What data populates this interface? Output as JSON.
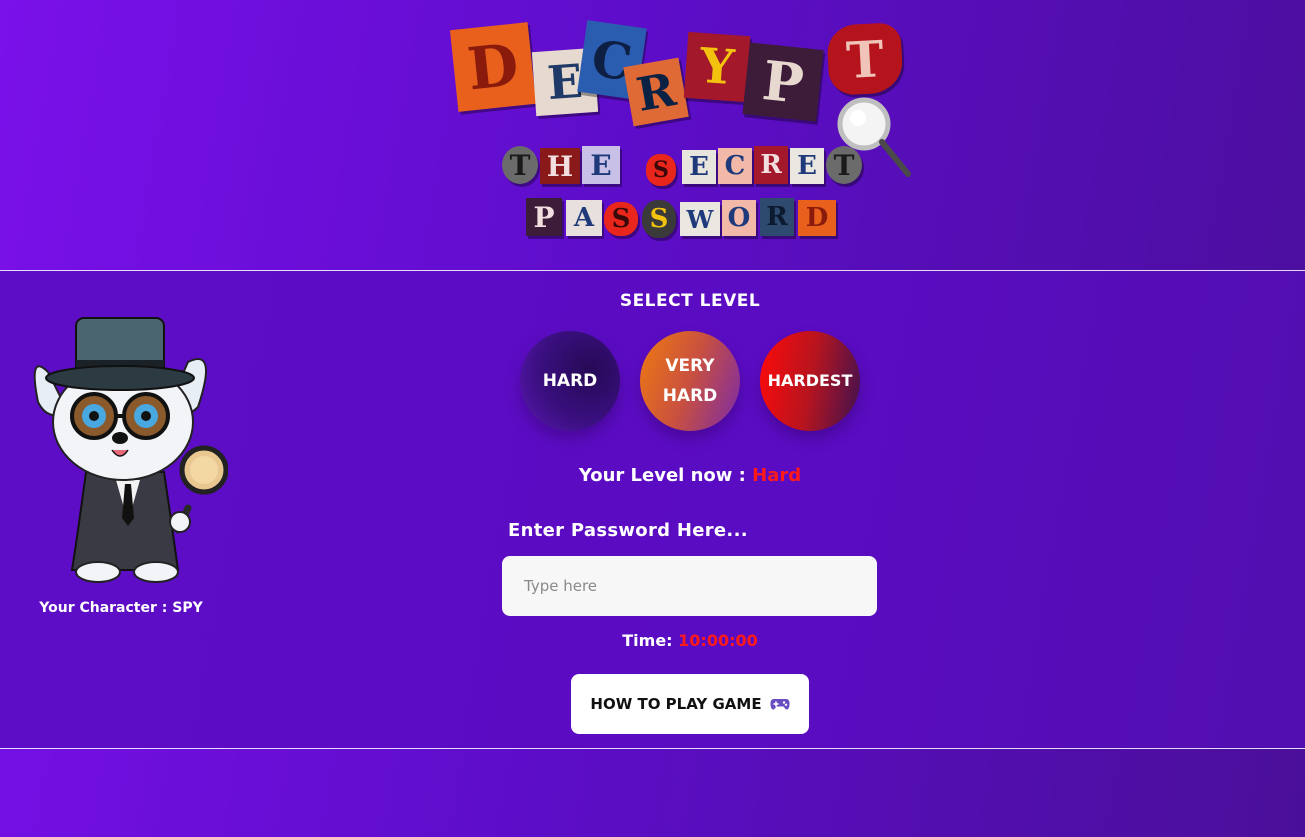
{
  "logo": {
    "title_letters": [
      "D",
      "E",
      "C",
      "R",
      "Y",
      "P",
      "T"
    ],
    "subtitle_line1": [
      "T",
      "H",
      "E",
      "S",
      "E",
      "C",
      "R",
      "E",
      "T"
    ],
    "subtitle_line2": [
      "P",
      "A",
      "S",
      "S",
      "W",
      "O",
      "R",
      "D"
    ]
  },
  "character": {
    "label": "Your Character : SPY"
  },
  "levels": {
    "heading": "SELECT LEVEL",
    "hard": "HARD",
    "very_hard": "VERY HARD",
    "hardest": "HARDEST",
    "current_prefix": "Your Level now :",
    "current_value": "Hard"
  },
  "password": {
    "label": "Enter Password Here...",
    "placeholder": "Type here",
    "value": ""
  },
  "timer": {
    "label": "Time:",
    "value": "10:00:00"
  },
  "help": {
    "button_label": "HOW TO PLAY GAME",
    "icon": "gamepad-icon"
  },
  "colors": {
    "background_start": "#7a10ea",
    "background_end": "#4a0f9a",
    "highlight_red": "#ff1a1a"
  }
}
